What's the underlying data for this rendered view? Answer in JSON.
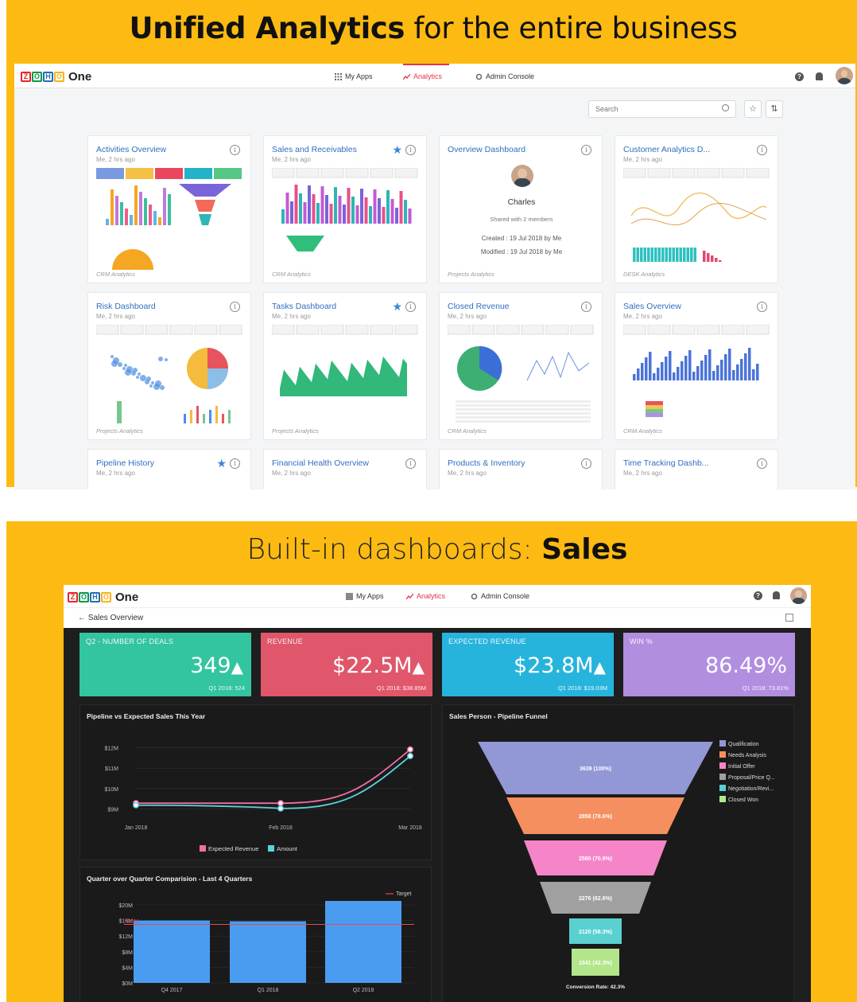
{
  "banner_top": {
    "bold": "Unified Analytics",
    "rest": "for the entire business"
  },
  "banner_bottom": {
    "text": "Built-in dashboards: ",
    "bold": "Sales"
  },
  "app": {
    "brand": "One",
    "nav": {
      "myapps": "My Apps",
      "analytics": "Analytics",
      "admin": "Admin Console"
    },
    "help": "?"
  },
  "toolbar": {
    "search_placeholder": "Search",
    "star": "☆",
    "sort": "⇅"
  },
  "dashboards": [
    {
      "title": "Activities Overview",
      "sub": "Me, 2 hrs ago",
      "foot": "CRM Analytics",
      "starred": false
    },
    {
      "title": "Sales and Receivables",
      "sub": "Me, 2 hrs ago",
      "foot": "CRM Analytics",
      "starred": true
    },
    {
      "title": "Overview Dashboard",
      "sub": "",
      "foot": "Projects Analytics",
      "starred": false
    },
    {
      "title": "Customer Analytics D...",
      "sub": "Me, 2 hrs ago",
      "foot": "DESK Analytics",
      "starred": false
    },
    {
      "title": "Risk Dashboard",
      "sub": "Me, 2 hrs ago",
      "foot": "Projects Analytics",
      "starred": false
    },
    {
      "title": "Tasks Dashboard",
      "sub": "Me, 2 hrs ago",
      "foot": "Projects Analytics",
      "starred": true
    },
    {
      "title": "Closed Revenue",
      "sub": "Me, 2 hrs ago",
      "foot": "CRM Analytics",
      "starred": false
    },
    {
      "title": "Sales Overview",
      "sub": "Me, 2 hrs ago",
      "foot": "CRM Analytics",
      "starred": false
    },
    {
      "title": "Pipeline History",
      "sub": "Me, 2 hrs ago",
      "foot": "",
      "starred": true
    },
    {
      "title": "Financial Health Overview",
      "sub": "Me, 2 hrs ago",
      "foot": "",
      "starred": false
    },
    {
      "title": "Products & Inventory",
      "sub": "Me, 2 hrs ago",
      "foot": "",
      "starred": false
    },
    {
      "title": "Time Tracking Dashb...",
      "sub": "Me, 2 hrs ago",
      "foot": "",
      "starred": false
    }
  ],
  "overview_card": {
    "name": "Charles",
    "shared": "Shared with 2 members",
    "created": "Created : 19 Jul 2018 by Me",
    "modified": "Modified : 19 Jul 2018 by Me"
  },
  "sales": {
    "back_label": "Sales Overview",
    "kpis": [
      {
        "label": "Q2 - NUMBER OF DEALS",
        "value": "349",
        "arrow": "▲",
        "compare": "Q1 2018: 524",
        "color": "#33c4a0"
      },
      {
        "label": "REVENUE",
        "value": "$22.5M",
        "arrow": "▲",
        "compare": "Q1 2018: $38.85M",
        "color": "#e0566a"
      },
      {
        "label": "EXPECTED REVENUE",
        "value": "$23.8M",
        "arrow": "▲",
        "compare": "Q1 2018: $19.03M",
        "color": "#27b4dc"
      },
      {
        "label": "WIN %",
        "value": "86.49%",
        "arrow": "",
        "compare": "Q1 2018: 73.81%",
        "color": "#b18ee0"
      }
    ],
    "line_title": "Pipeline vs Expected Sales This Year",
    "bar_title": "Quarter over Quarter Comparision - Last 4 Quarters",
    "funnel_title": "Sales Person - Pipeline Funnel",
    "conversion": "Conversion Rate: 42.3%",
    "bar_target_label": "Target",
    "bar_target_value": "$15M"
  },
  "chart_data": [
    {
      "type": "line",
      "title": "Pipeline vs Expected Sales This Year",
      "categories": [
        "Jan 2018",
        "Feb 2018",
        "Mar 2018"
      ],
      "yticks": [
        "$12M",
        "$11M",
        "$10M",
        "$9M"
      ],
      "ylim": [
        8.7,
        12.3
      ],
      "series": [
        {
          "name": "Expected Revenue",
          "color": "#f06fa6",
          "values": [
            9.28,
            9.28,
            11.92
          ]
        },
        {
          "name": "Amount",
          "color": "#5ad2d8",
          "values": [
            9.18,
            9.02,
            11.6
          ]
        }
      ]
    },
    {
      "type": "bar",
      "title": "Quarter over Quarter Comparision - Last 4 Quarters",
      "categories": [
        "Q4 2017",
        "Q1 2018",
        "Q2 2018"
      ],
      "yticks": [
        "$20M",
        "$16M",
        "$12M",
        "$8M",
        "$4M",
        "$0M"
      ],
      "ylim": [
        0,
        20
      ],
      "values": [
        16,
        15.8,
        22.5
      ],
      "target": 15,
      "color": "#4a9cf0"
    },
    {
      "type": "funnel",
      "title": "Sales Person - Pipeline Funnel",
      "stages": [
        {
          "name": "Qualification",
          "label": "3639 (100%)",
          "color": "#9297d6"
        },
        {
          "name": "Needs Analysis",
          "label": "2858 (78.6%)",
          "color": "#f68f5f"
        },
        {
          "name": "Initial Offer",
          "label": "2580 (70.9%)",
          "color": "#f585c8"
        },
        {
          "name": "Proposal/Price Q...",
          "label": "2276 (62.6%)",
          "color": "#a0a0a0"
        },
        {
          "name": "Negotiation/Revi...",
          "label": "2120 (58.3%)",
          "color": "#5ad0d0"
        },
        {
          "name": "Closed Won",
          "label": "1541 (42.3%)",
          "color": "#b3e58a"
        }
      ]
    }
  ]
}
